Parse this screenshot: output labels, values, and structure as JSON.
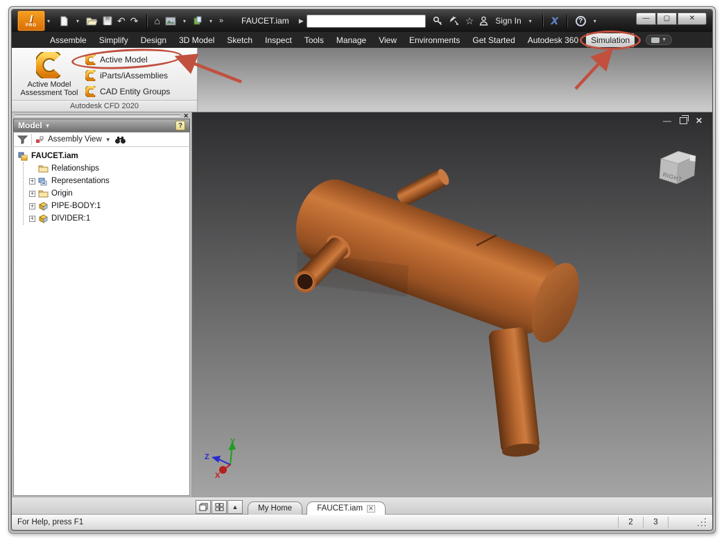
{
  "window": {
    "title": "FAUCET.iam",
    "app_badge": "PRO",
    "app_letter": "I"
  },
  "titlebar": {
    "document_title": "FAUCET.iam",
    "search_value": "",
    "sign_in_label": "Sign In",
    "exchange_logo": "X",
    "help_glyph": "?"
  },
  "ribbon": {
    "tabs": [
      "Assemble",
      "Simplify",
      "Design",
      "3D Model",
      "Sketch",
      "Inspect",
      "Tools",
      "Manage",
      "View",
      "Environments",
      "Get Started",
      "Autodesk 360",
      "Simulation"
    ],
    "active_tab": "Simulation",
    "cfd_panel": {
      "large_button_line1": "Active Model",
      "large_button_line2": "Assessment Tool",
      "buttons": [
        "Active Model",
        "iParts/iAssemblies",
        "CAD Entity Groups"
      ],
      "footer": "Autodesk CFD 2020"
    }
  },
  "browser": {
    "header_title": "Model",
    "view_mode": "Assembly View",
    "tree": [
      {
        "label": "FAUCET.iam",
        "icon": "assembly-icon"
      },
      {
        "label": "Relationships",
        "icon": "folder-icon"
      },
      {
        "label": "Representations",
        "icon": "representations-icon"
      },
      {
        "label": "Origin",
        "icon": "folder-icon"
      },
      {
        "label": "PIPE-BODY:1",
        "icon": "part-icon"
      },
      {
        "label": "DIVIDER:1",
        "icon": "part-icon"
      }
    ]
  },
  "viewport": {
    "viewcube_face": "RIGHT",
    "axis_labels": {
      "x": "X",
      "y": "Y",
      "z": "Z"
    }
  },
  "doc_tabs": [
    {
      "label": "My Home"
    },
    {
      "label": "FAUCET.iam"
    }
  ],
  "statusbar": {
    "message": "For Help, press F1",
    "cells": [
      "2",
      "3"
    ]
  },
  "colors": {
    "annotation_red": "#c1503f",
    "copper_base": "#b4632c",
    "viewport_top": "#2d2d2f",
    "viewport_bottom": "#a6a6a6"
  }
}
